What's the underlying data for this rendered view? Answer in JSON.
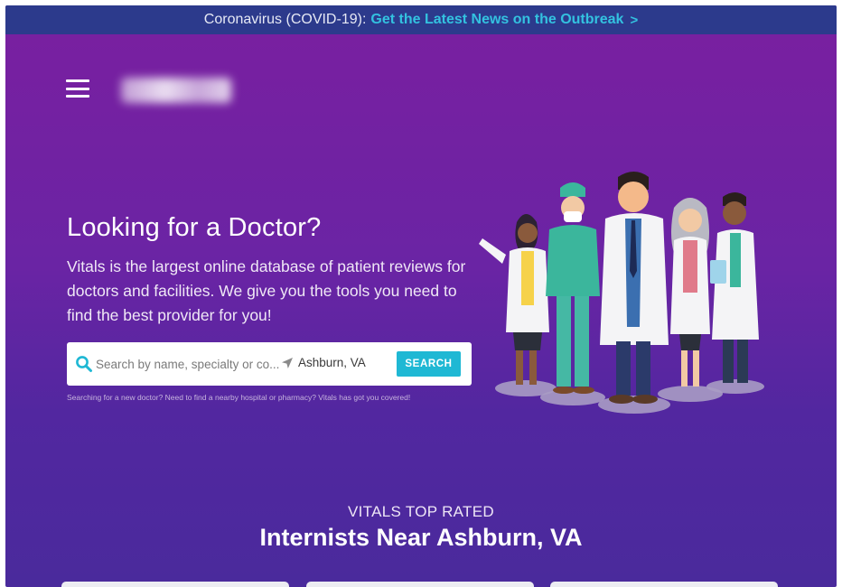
{
  "announcement": {
    "prefix": "Coronavirus (COVID-19):",
    "link_label": "Get the Latest News on the Outbreak",
    "chevron": ">"
  },
  "header": {
    "menu_icon": "hamburger-menu-icon",
    "logo_icon": "vitals-logo"
  },
  "hero": {
    "title": "Looking for a Doctor?",
    "description": "Vitals is the largest online database of patient reviews for doctors and facilities. We give you the tools you need to find the best provider for you!",
    "illustration": "doctors-group-illustration"
  },
  "search": {
    "icon": "search-icon",
    "placeholder": "Search by name, specialty or co...",
    "location_icon": "location-arrow-icon",
    "location_value": "Ashburn, VA",
    "button_label": "SEARCH",
    "helper_text": "Searching for a new doctor? Need to find a nearby hospital or pharmacy? Vitals has got you covered!"
  },
  "top_rated": {
    "kicker": "VITALS TOP RATED",
    "title": "Internists Near Ashburn, VA"
  },
  "colors": {
    "accent": "#1fb8d4",
    "banner": "#2c3a8c",
    "link": "#33c2e0",
    "bg_top": "#7a1fa0",
    "bg_bottom": "#4a2a9c"
  }
}
